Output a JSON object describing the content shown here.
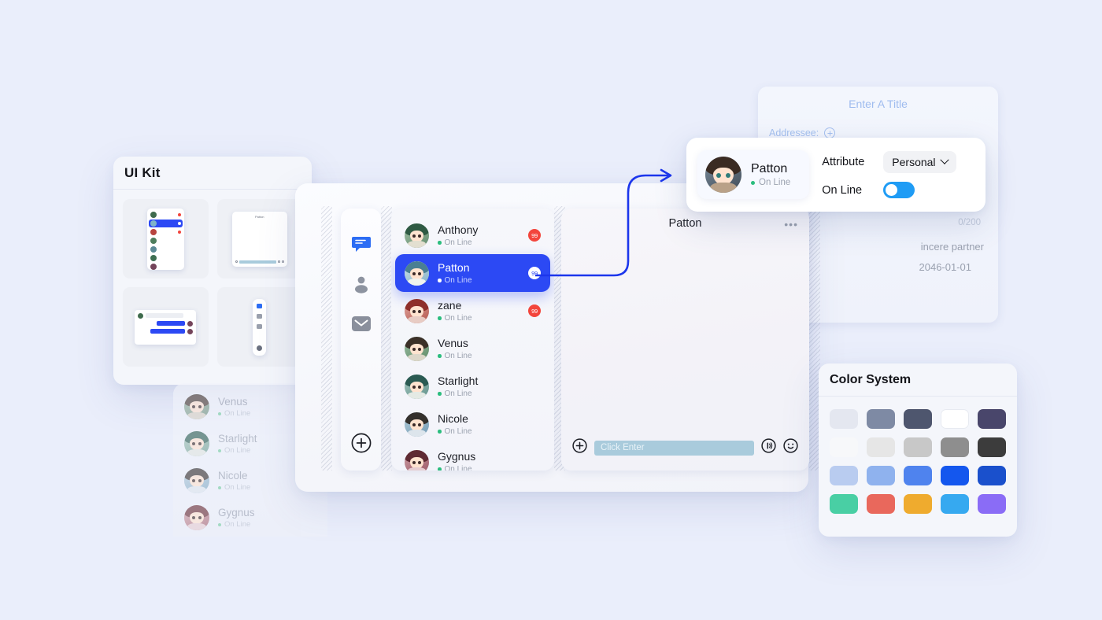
{
  "uikit": {
    "title": "UI Kit",
    "thumbnails": [
      {
        "name": "contact-list-preview"
      },
      {
        "name": "chat-window-preview"
      },
      {
        "name": "message-bubbles-preview"
      },
      {
        "name": "nav-rail-preview"
      }
    ]
  },
  "nav_rail": {
    "items": [
      {
        "icon": "chat-bubble-icon",
        "active": true
      },
      {
        "icon": "person-icon",
        "active": false
      },
      {
        "icon": "mail-icon",
        "active": false
      }
    ],
    "add_icon": "plus-circle-icon"
  },
  "contacts": {
    "items": [
      {
        "name": "Anthony",
        "status": "On Line",
        "badge": "99",
        "selected": false
      },
      {
        "name": "Patton",
        "status": "On Line",
        "badge": "99",
        "selected": true
      },
      {
        "name": "zane",
        "status": "On Line",
        "badge": "99",
        "selected": false
      },
      {
        "name": "Venus",
        "status": "On Line",
        "badge": "",
        "selected": false
      },
      {
        "name": "Starlight",
        "status": "On Line",
        "badge": "",
        "selected": false
      },
      {
        "name": "Nicole",
        "status": "On Line",
        "badge": "",
        "selected": false
      },
      {
        "name": "Gygnus",
        "status": "On Line",
        "badge": "",
        "selected": false
      }
    ]
  },
  "ghost_contacts": {
    "items": [
      {
        "name": "Venus",
        "status": "On Line"
      },
      {
        "name": "Starlight",
        "status": "On Line"
      },
      {
        "name": "Nicole",
        "status": "On Line"
      },
      {
        "name": "Gygnus",
        "status": "On Line"
      }
    ]
  },
  "chat": {
    "title": "Patton",
    "more_icon": "more-horizontal-icon",
    "add_icon": "plus-circle-icon",
    "input_placeholder": "Click Enter",
    "voice_icon": "voice-icon",
    "emoji_icon": "smiley-icon"
  },
  "compose": {
    "title_placeholder": "Enter A Title",
    "addressee_label": "Addressee:",
    "addressee_add_icon": "plus-circle-icon",
    "counter": "0/200",
    "signature": "incere partner",
    "date": "2046-01-01"
  },
  "detail": {
    "person": {
      "name": "Patton",
      "status": "On Line"
    },
    "attribute_label": "Attribute",
    "attribute_value": "Personal",
    "attribute_chevron": "chevron-down-icon",
    "online_label": "On Line",
    "online_enabled": true
  },
  "color_system": {
    "title": "Color System",
    "swatches": [
      "#e4e7f0",
      "#7e8aa4",
      "#4e566e",
      "#ffffff",
      "#49466b",
      "#f7f8fa",
      "#e6e6e6",
      "#c8c8c8",
      "#8e8e8e",
      "#3c3c3c",
      "#b9ccf0",
      "#8fb2ee",
      "#4f83ee",
      "#1457ee",
      "#1a50cc",
      "#49cfa4",
      "#e9685c",
      "#efab2e",
      "#36a9f0",
      "#8a6cf6"
    ]
  },
  "theme": {
    "page_bg": "#eaeefb",
    "accent_blue": "#2c49f4",
    "online_green": "#2bbd7e",
    "badge_red": "#f3453c",
    "toggle_blue": "#1f9cf5",
    "arrow_blue": "#1c36ec"
  }
}
